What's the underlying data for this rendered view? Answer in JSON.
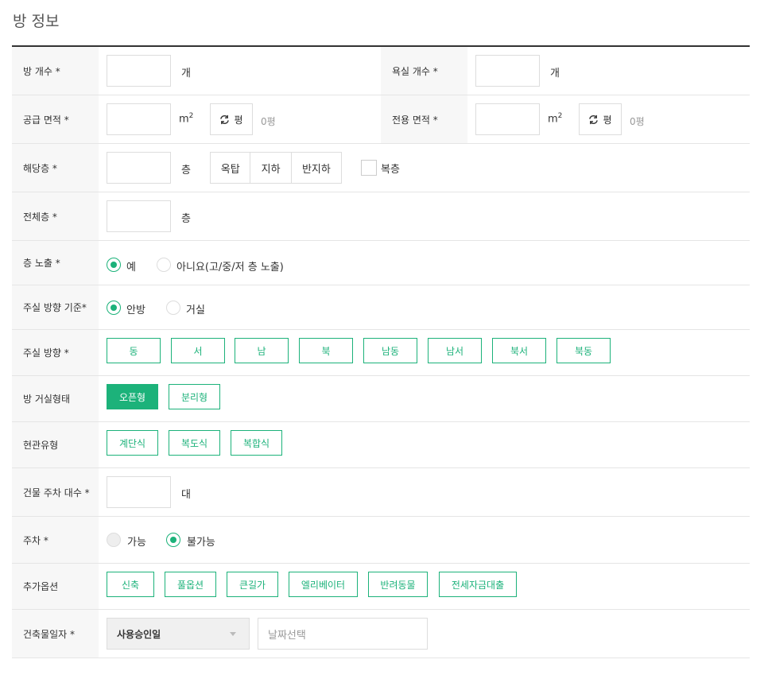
{
  "section": {
    "title": "방 정보"
  },
  "rows": {
    "room_count": {
      "label": "방 개수 *",
      "unit": "개"
    },
    "bath_count": {
      "label": "욕실 개수 *",
      "unit": "개"
    },
    "supply_area": {
      "label": "공급 면적 *",
      "unit": "m",
      "unit_sup": "2",
      "convert_label": "평",
      "pyeong_value": "0평"
    },
    "exclusive_area": {
      "label": "전용 면적 *",
      "unit": "m",
      "unit_sup": "2",
      "convert_label": "평",
      "pyeong_value": "0평"
    },
    "floor": {
      "label": "해당층 *",
      "unit": "층",
      "options": [
        "옥탑",
        "지하",
        "반지하"
      ],
      "duplex_label": "복층"
    },
    "total_floors": {
      "label": "전체층 *",
      "unit": "층"
    },
    "floor_exposure": {
      "label": "층 노출 *",
      "options": [
        "예",
        "아니요(고/중/저 층 노출)"
      ],
      "selected": "예"
    },
    "direction_basis": {
      "label": "주실 방향 기준*",
      "options": [
        "안방",
        "거실"
      ],
      "selected": "안방"
    },
    "direction": {
      "label": "주실 방향 *",
      "options": [
        "동",
        "서",
        "남",
        "북",
        "남동",
        "남서",
        "북서",
        "북동"
      ]
    },
    "room_type": {
      "label": "방 거실형태",
      "options": [
        "오픈형",
        "분리형"
      ],
      "selected": "오픈형"
    },
    "entrance_type": {
      "label": "현관유형",
      "options": [
        "계단식",
        "복도식",
        "복합식"
      ]
    },
    "parking_count": {
      "label": "건물 주차 대수 *",
      "unit": "대"
    },
    "parking": {
      "label": "주차 *",
      "options": [
        "가능",
        "불가능"
      ],
      "selected": "불가능"
    },
    "extra_options": {
      "label": "추가옵션",
      "options": [
        "신축",
        "풀옵션",
        "큰길가",
        "엘리베이터",
        "반려동물",
        "전세자금대출"
      ]
    },
    "build_date": {
      "label": "건축물일자 *",
      "select_value": "사용승인일",
      "date_placeholder": "날짜선택"
    }
  },
  "colors": {
    "accent": "#1cb27a",
    "label_bg": "#f7f7f7",
    "border": "#dddddd"
  }
}
